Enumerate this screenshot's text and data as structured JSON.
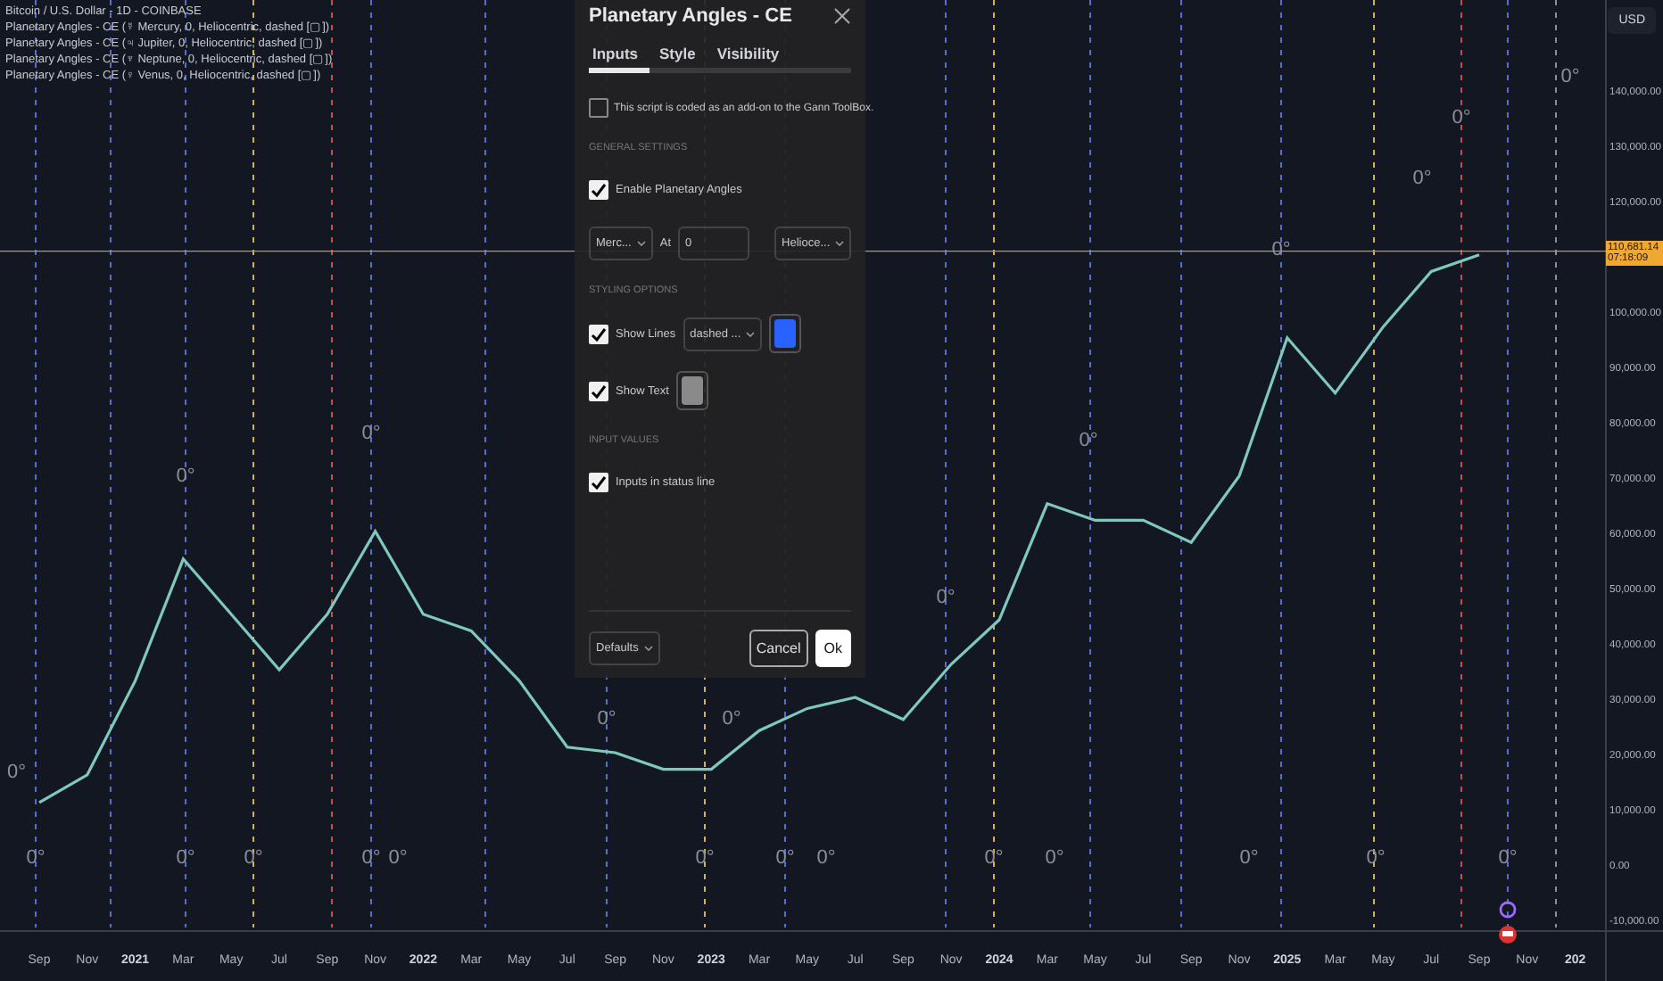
{
  "legend": {
    "symbol": "Bitcoin / U.S. Dollar - 1D - COINBASE",
    "indicators": [
      "Planetary Angles - CE (☿ Mercury, 0, Heliocentric, dashed [▢])",
      "Planetary Angles - CE (♃ Jupiter, 0, Heliocentric, dashed [▢])",
      "Planetary Angles - CE (♆ Neptune, 0, Heliocentric, dashed [▢])",
      "Planetary Angles - CE (♀ Venus, 0, Heliocentric, dashed [▢])"
    ]
  },
  "currency_button": "USD",
  "price_tag": {
    "price": "110,681.14",
    "countdown": "07:18:09"
  },
  "angle_labels": [
    "0°",
    "0°",
    "0°",
    "0°",
    "0°",
    "0°",
    "0°",
    "0°",
    "0°",
    "0°",
    "0°",
    "0°",
    "0°",
    "0°",
    "0°",
    "0°",
    "0°",
    "0°",
    "0°",
    "0°",
    "0°",
    "0°",
    "0°",
    "0°"
  ],
  "chart_data": {
    "type": "line",
    "categories": [
      "Sep",
      "Nov",
      "2021",
      "Mar",
      "May",
      "Jul",
      "Sep",
      "Nov",
      "2022",
      "Mar",
      "May",
      "Jul",
      "Sep",
      "Nov",
      "2023",
      "Mar",
      "May",
      "Jul",
      "Sep",
      "Nov",
      "2024",
      "Mar",
      "May",
      "Jul",
      "Sep",
      "Nov",
      "2025",
      "Mar",
      "May",
      "Jul",
      "Sep",
      "Nov",
      "202"
    ],
    "series": [
      {
        "color": "#7ec8c0",
        "values": [
          11000,
          16000,
          33000,
          55000,
          45000,
          35000,
          45000,
          60000,
          45000,
          42000,
          33000,
          21000,
          20000,
          17000,
          17000,
          24000,
          28000,
          30000,
          26000,
          36000,
          44000,
          65000,
          62000,
          62000,
          58000,
          70000,
          95000,
          85000,
          97000,
          107000,
          110000,
          null,
          null
        ]
      }
    ],
    "ylim": [
      -21300,
      156100
    ],
    "yticks": [
      {
        "value": 140000,
        "label": "140,000.00"
      },
      {
        "value": 130000,
        "label": "130,000.00"
      },
      {
        "value": 120000,
        "label": "120,000.00"
      },
      {
        "value": 100000,
        "label": "100,000.00"
      },
      {
        "value": 90000,
        "label": "90,000.00"
      },
      {
        "value": 80000,
        "label": "80,000.00"
      },
      {
        "value": 70000,
        "label": "70,000.00"
      },
      {
        "value": 60000,
        "label": "60,000.00"
      },
      {
        "value": 50000,
        "label": "50,000.00"
      },
      {
        "value": 40000,
        "label": "40,000.00"
      },
      {
        "value": 30000,
        "label": "30,000.00"
      },
      {
        "value": 20000,
        "label": "20,000.00"
      },
      {
        "value": 10000,
        "label": "10,000.00"
      },
      {
        "value": 0,
        "label": "0.00"
      },
      {
        "value": -10000,
        "label": "-10,000.00"
      }
    ],
    "ref_lines": [
      {
        "axis": "y",
        "value": 110681.14,
        "color": "#b8985a"
      }
    ]
  },
  "dialog": {
    "title": "Planetary Angles - CE",
    "tabs": [
      {
        "label": "Inputs",
        "selected": true
      },
      {
        "label": "Style",
        "selected": false
      },
      {
        "label": "Visibility",
        "selected": false
      }
    ],
    "note": {
      "label": "This script is coded as an add-on to the Gann ToolBox.",
      "checked": false
    },
    "sections": [
      {
        "heading": "GENERAL SETTINGS",
        "rows": [
          {
            "kind": "check",
            "label": "Enable Planetary Angles",
            "checked": true
          },
          {
            "kind": "inputs",
            "planet": "Merc...",
            "at_label": "At",
            "at_value": "0",
            "mode": "Helioce..."
          }
        ]
      },
      {
        "heading": "STYLING OPTIONS",
        "rows": [
          {
            "kind": "check",
            "label": "Show Lines",
            "checked": true,
            "select": "dashed ...",
            "color": "#2962ff"
          },
          {
            "kind": "check",
            "label": "Show Text",
            "checked": true,
            "color": "#8a8a8a"
          }
        ]
      },
      {
        "heading": "INPUT VALUES",
        "rows": [
          {
            "kind": "check",
            "label": "Inputs in status line",
            "checked": true
          }
        ]
      }
    ],
    "defaults": "Defaults",
    "cancel": "Cancel",
    "ok": "Ok"
  }
}
